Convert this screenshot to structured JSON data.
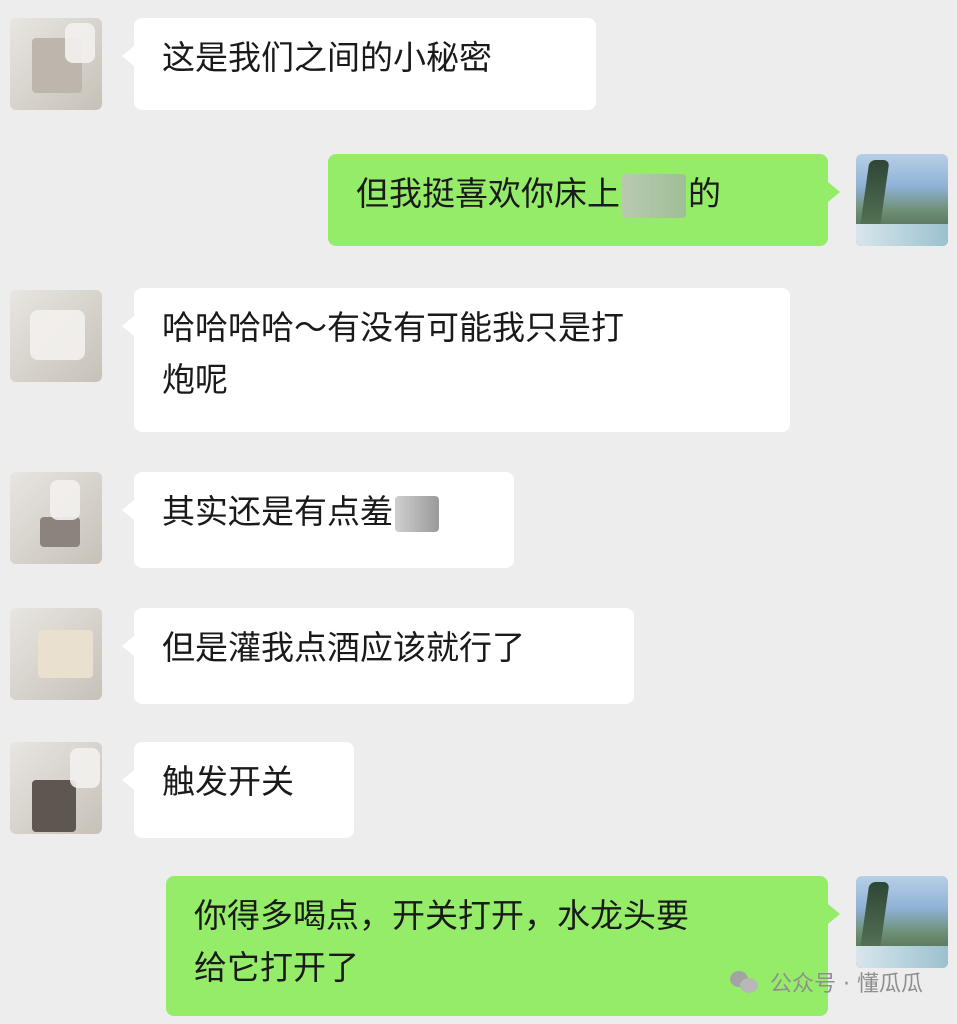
{
  "messages": [
    {
      "side": "in",
      "text": "这是我们之间的小秘密"
    },
    {
      "side": "out",
      "text_before": "但我挺喜欢你床上",
      "text_after": "的"
    },
    {
      "side": "in",
      "line1": "哈哈哈哈～有没有可能我只是打",
      "line2": "炮呢"
    },
    {
      "side": "in",
      "text": "其实还是有点羞"
    },
    {
      "side": "in",
      "text": "但是灌我点酒应该就行了"
    },
    {
      "side": "in",
      "text": "触发开关"
    },
    {
      "side": "out",
      "line1": "你得多喝点，开关打开，水龙头要",
      "line2": "给它打开了"
    }
  ],
  "watermark": {
    "text": "公众号 · 懂瓜瓜",
    "icon": "wechat-icon"
  },
  "colors": {
    "background": "#ededed",
    "incoming_bubble": "#ffffff",
    "outgoing_bubble": "#95ec69"
  }
}
